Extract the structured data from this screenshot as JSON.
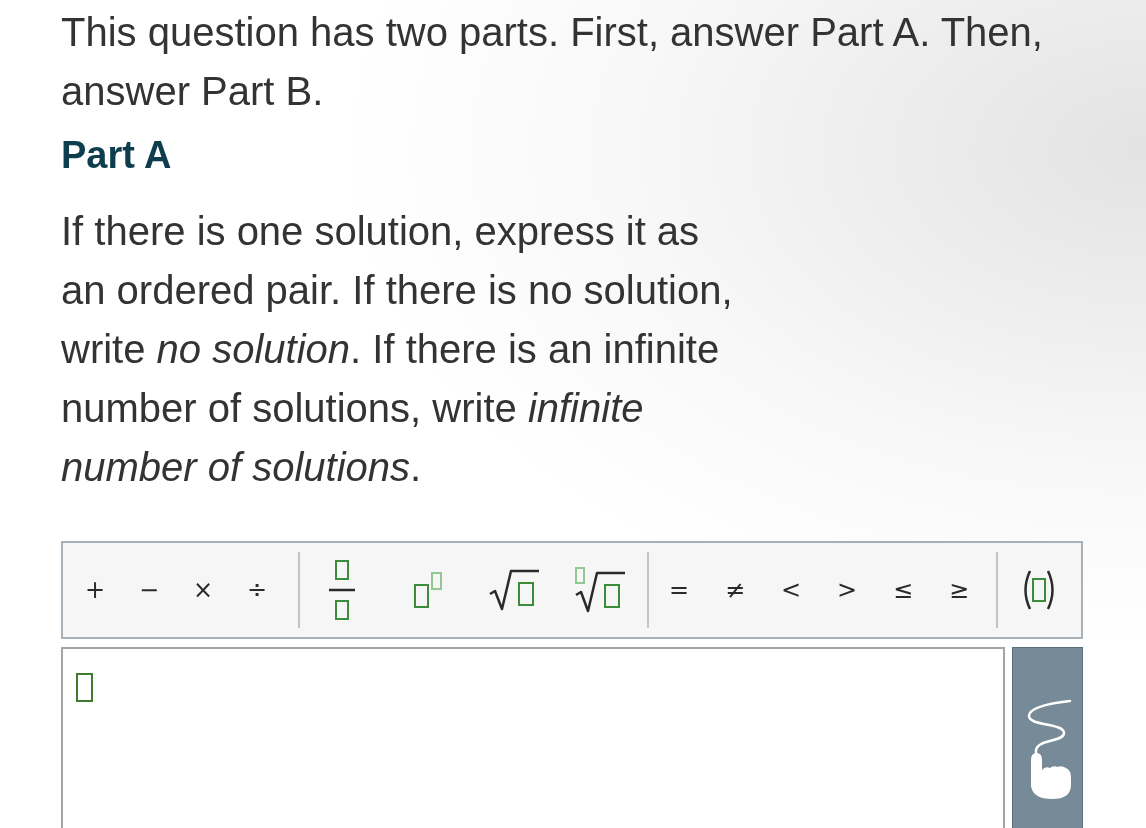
{
  "intro": "This question has two parts. First, answer Part A. Then, answer Part B.",
  "part_heading": "Part A",
  "instructions": "If there is one solution, express it as an ordered pair. If there is no solution, write *no solution*. If there is an infinite number of solutions, write *infinite number of solutions*.",
  "toolbar": {
    "groups": [
      {
        "buttons": [
          {
            "kind": "symbol",
            "label": "+"
          },
          {
            "kind": "symbol",
            "label": "−"
          },
          {
            "kind": "symbol",
            "label": "×"
          },
          {
            "kind": "symbol",
            "label": "÷"
          }
        ]
      },
      {
        "buttons": [
          {
            "kind": "fraction"
          },
          {
            "kind": "superscript"
          },
          {
            "kind": "square_root"
          },
          {
            "kind": "nth_root"
          }
        ]
      },
      {
        "buttons": [
          {
            "kind": "symbol",
            "label": "="
          },
          {
            "kind": "symbol",
            "label": "≠"
          },
          {
            "kind": "symbol",
            "label": "<"
          },
          {
            "kind": "symbol",
            "label": ">"
          },
          {
            "kind": "symbol",
            "label": "≤"
          },
          {
            "kind": "symbol",
            "label": "≥"
          }
        ]
      },
      {
        "buttons": [
          {
            "kind": "parentheses"
          }
        ]
      }
    ]
  }
}
